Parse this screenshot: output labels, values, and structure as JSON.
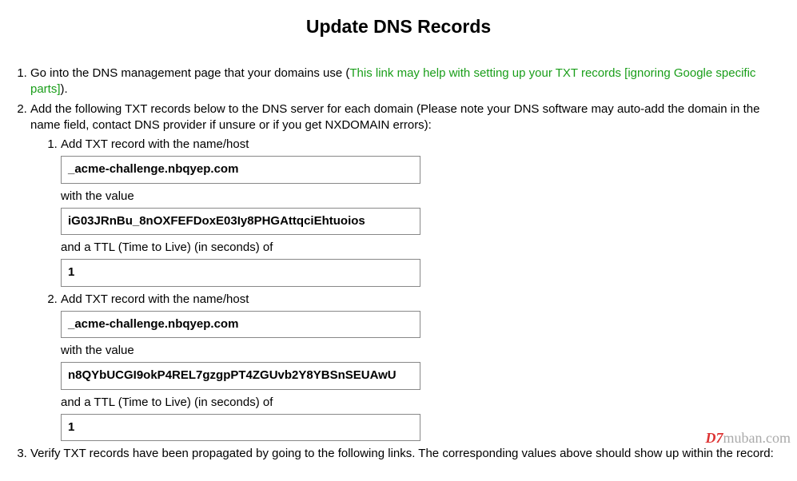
{
  "title": "Update DNS Records",
  "step1": {
    "prefix": "Go into the DNS management page that your domains use (",
    "link_text": "This link may help with setting up your TXT records [ignoring Google specific parts]",
    "suffix": ")."
  },
  "step2": {
    "intro": "Add the following TXT records below to the DNS server for each domain (Please note your DNS software may auto-add the domain in the name field, contact DNS provider if unsure or if you get NXDOMAIN errors):",
    "records": [
      {
        "heading": "Add TXT record with the name/host",
        "name": "_acme-challenge.nbqyep.com",
        "value_label": "with the value",
        "value": "iG03JRnBu_8nOXFEFDoxE03Iy8PHGAttqciEhtuoios",
        "ttl_label": "and a TTL (Time to Live) (in seconds) of",
        "ttl": "1"
      },
      {
        "heading": "Add TXT record with the name/host",
        "name": "_acme-challenge.nbqyep.com",
        "value_label": "with the value",
        "value": "n8QYbUCGI9okP4REL7gzgpPT4ZGUvb2Y8YBSnSEUAwU",
        "ttl_label": "and a TTL (Time to Live) (in seconds) of",
        "ttl": "1"
      }
    ]
  },
  "step3": "Verify TXT records have been propagated by going to the following links. The corresponding values above should show up within the record:",
  "watermark": {
    "prefix": "D7",
    "suffix": "muban.com"
  }
}
